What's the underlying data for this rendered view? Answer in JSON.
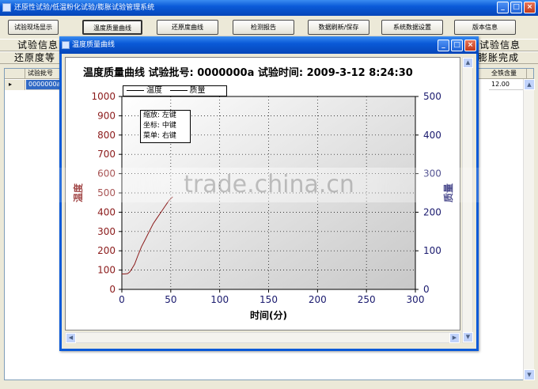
{
  "main_window": {
    "title": "还原性试验/低温粉化试验/膨胀试验管理系统",
    "minimize": "_",
    "maximize": "□",
    "close": "×"
  },
  "toolbar": {
    "buttons": [
      {
        "label": "试验现场显示"
      },
      {
        "label": "温度质量曲线"
      },
      {
        "label": "还原度曲线"
      },
      {
        "label": "检测报告"
      },
      {
        "label": "数据刷新/保存"
      },
      {
        "label": "系统数据设置"
      },
      {
        "label": "版本信息"
      }
    ]
  },
  "header_rows": {
    "row1_left": "试验信息",
    "row1_right": "试验信息",
    "row2_left": "还原度等",
    "row2_right": "膨胀完成"
  },
  "grid": {
    "columns": [
      "试验批号",
      "全铁含量"
    ],
    "row_marker": "▸",
    "rows": [
      {
        "batch": "0000000a",
        "total_iron": "12.00"
      }
    ]
  },
  "dialog": {
    "title": "温度质量曲线",
    "minimize": "_",
    "maximize": "□",
    "close": "×",
    "heading": "温度质量曲线  试验批号: 0000000a    试验时间: 2009-3-12 8:24:30",
    "legend": {
      "temp": "温度",
      "mass": "质量"
    },
    "hint": {
      "zoom": "缩放: 左键",
      "coord": "坐标: 中键",
      "menu": "菜单: 右键"
    }
  },
  "chart_data": {
    "type": "line",
    "title": "温度质量曲线  试验批号: 0000000a    试验时间: 2009-3-12 8:24:30",
    "xlabel": "时间(分)",
    "ylabel": "温度",
    "y2label": "质量",
    "xlim": [
      0,
      300
    ],
    "ylim": [
      0,
      1000
    ],
    "y2lim": [
      0,
      500
    ],
    "x_ticks": [
      0,
      50,
      100,
      150,
      200,
      250,
      300
    ],
    "y_ticks": [
      0,
      100,
      200,
      300,
      400,
      500,
      600,
      700,
      800,
      900,
      1000
    ],
    "y2_ticks": [
      0,
      100,
      200,
      300,
      400,
      500
    ],
    "grid": true,
    "series": [
      {
        "name": "温度",
        "color": "#8b1a1a",
        "x": [
          0,
          3,
          6,
          8,
          10,
          13,
          16,
          20,
          24,
          28,
          32,
          36,
          40,
          44,
          48,
          52
        ],
        "y": [
          80,
          80,
          82,
          90,
          105,
          130,
          170,
          220,
          260,
          300,
          340,
          370,
          400,
          430,
          460,
          480
        ]
      }
    ],
    "colors": {
      "left_axis": "#8b1a1a",
      "right_axis": "#1a1a6e"
    }
  },
  "watermark": "trade.china.cn"
}
